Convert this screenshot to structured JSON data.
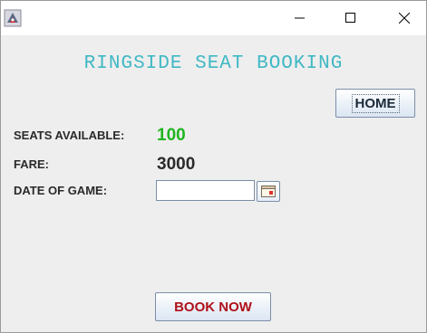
{
  "window": {
    "title": "",
    "app_icon": "java-app-icon",
    "controls": {
      "minimize_icon": "minimize-icon",
      "maximize_icon": "maximize-icon",
      "close_icon": "close-icon"
    }
  },
  "heading": "RINGSIDE SEAT BOOKING",
  "home_button": {
    "label": "HOME"
  },
  "fields": {
    "seats_label": "SEATS AVAILABLE:",
    "seats_value": "100",
    "fare_label": "FARE:",
    "fare_value": "3000",
    "date_label": "DATE OF GAME:",
    "date_value": "",
    "calendar_icon": "calendar-icon"
  },
  "book_button": {
    "label": "BOOK NOW"
  },
  "colors": {
    "heading": "#3fb8c4",
    "seats_value": "#1fb51f",
    "book_label": "#b0101a",
    "background": "#eeeeee"
  }
}
